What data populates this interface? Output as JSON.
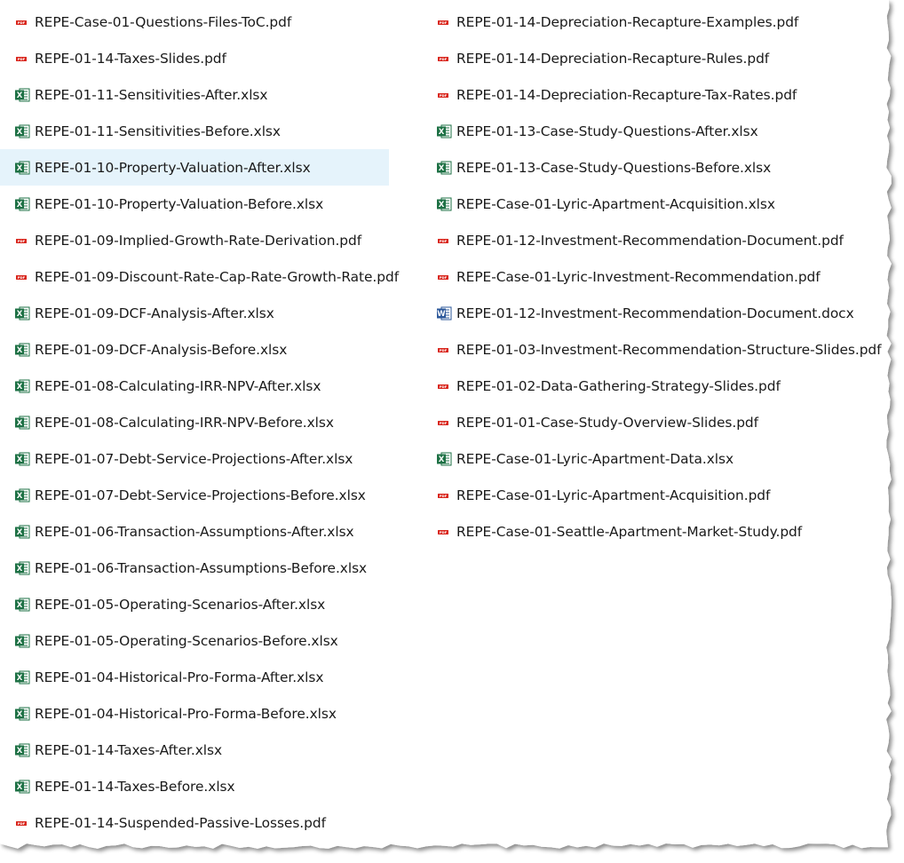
{
  "left_column": [
    {
      "name": "REPE-Case-01-Questions-Files-ToC.pdf",
      "type": "pdf"
    },
    {
      "name": "REPE-01-14-Taxes-Slides.pdf",
      "type": "pdf"
    },
    {
      "name": "REPE-01-11-Sensitivities-After.xlsx",
      "type": "xlsx"
    },
    {
      "name": "REPE-01-11-Sensitivities-Before.xlsx",
      "type": "xlsx"
    },
    {
      "name": "REPE-01-10-Property-Valuation-After.xlsx",
      "type": "xlsx",
      "selected": true
    },
    {
      "name": "REPE-01-10-Property-Valuation-Before.xlsx",
      "type": "xlsx"
    },
    {
      "name": "REPE-01-09-Implied-Growth-Rate-Derivation.pdf",
      "type": "pdf"
    },
    {
      "name": "REPE-01-09-Discount-Rate-Cap-Rate-Growth-Rate.pdf",
      "type": "pdf"
    },
    {
      "name": "REPE-01-09-DCF-Analysis-After.xlsx",
      "type": "xlsx"
    },
    {
      "name": "REPE-01-09-DCF-Analysis-Before.xlsx",
      "type": "xlsx"
    },
    {
      "name": "REPE-01-08-Calculating-IRR-NPV-After.xlsx",
      "type": "xlsx"
    },
    {
      "name": "REPE-01-08-Calculating-IRR-NPV-Before.xlsx",
      "type": "xlsx"
    },
    {
      "name": "REPE-01-07-Debt-Service-Projections-After.xlsx",
      "type": "xlsx"
    },
    {
      "name": "REPE-01-07-Debt-Service-Projections-Before.xlsx",
      "type": "xlsx"
    },
    {
      "name": "REPE-01-06-Transaction-Assumptions-After.xlsx",
      "type": "xlsx"
    },
    {
      "name": "REPE-01-06-Transaction-Assumptions-Before.xlsx",
      "type": "xlsx"
    },
    {
      "name": "REPE-01-05-Operating-Scenarios-After.xlsx",
      "type": "xlsx"
    },
    {
      "name": "REPE-01-05-Operating-Scenarios-Before.xlsx",
      "type": "xlsx"
    },
    {
      "name": "REPE-01-04-Historical-Pro-Forma-After.xlsx",
      "type": "xlsx"
    },
    {
      "name": "REPE-01-04-Historical-Pro-Forma-Before.xlsx",
      "type": "xlsx"
    },
    {
      "name": "REPE-01-14-Taxes-After.xlsx",
      "type": "xlsx"
    },
    {
      "name": "REPE-01-14-Taxes-Before.xlsx",
      "type": "xlsx"
    },
    {
      "name": "REPE-01-14-Suspended-Passive-Losses.pdf",
      "type": "pdf"
    }
  ],
  "right_column": [
    {
      "name": "REPE-01-14-Depreciation-Recapture-Examples.pdf",
      "type": "pdf"
    },
    {
      "name": "REPE-01-14-Depreciation-Recapture-Rules.pdf",
      "type": "pdf"
    },
    {
      "name": "REPE-01-14-Depreciation-Recapture-Tax-Rates.pdf",
      "type": "pdf"
    },
    {
      "name": "REPE-01-13-Case-Study-Questions-After.xlsx",
      "type": "xlsx"
    },
    {
      "name": "REPE-01-13-Case-Study-Questions-Before.xlsx",
      "type": "xlsx"
    },
    {
      "name": "REPE-Case-01-Lyric-Apartment-Acquisition.xlsx",
      "type": "xlsx"
    },
    {
      "name": "REPE-01-12-Investment-Recommendation-Document.pdf",
      "type": "pdf"
    },
    {
      "name": "REPE-Case-01-Lyric-Investment-Recommendation.pdf",
      "type": "pdf"
    },
    {
      "name": "REPE-01-12-Investment-Recommendation-Document.docx",
      "type": "docx"
    },
    {
      "name": "REPE-01-03-Investment-Recommendation-Structure-Slides.pdf",
      "type": "pdf"
    },
    {
      "name": "REPE-01-02-Data-Gathering-Strategy-Slides.pdf",
      "type": "pdf"
    },
    {
      "name": "REPE-01-01-Case-Study-Overview-Slides.pdf",
      "type": "pdf"
    },
    {
      "name": "REPE-Case-01-Lyric-Apartment-Data.xlsx",
      "type": "xlsx"
    },
    {
      "name": "REPE-Case-01-Lyric-Apartment-Acquisition.pdf",
      "type": "pdf"
    },
    {
      "name": "REPE-Case-01-Seattle-Apartment-Market-Study.pdf",
      "type": "pdf"
    }
  ],
  "icons": {
    "pdf": {
      "name": "pdf-file-icon",
      "label": "PDF",
      "color": "#d9261c"
    },
    "xlsx": {
      "name": "excel-file-icon",
      "label": "X",
      "color": "#1e7145"
    },
    "docx": {
      "name": "word-file-icon",
      "label": "W",
      "color": "#2b579a"
    }
  },
  "colors": {
    "selection": "#e5f3fb",
    "text": "#1a1a1a",
    "background": "#ffffff"
  }
}
